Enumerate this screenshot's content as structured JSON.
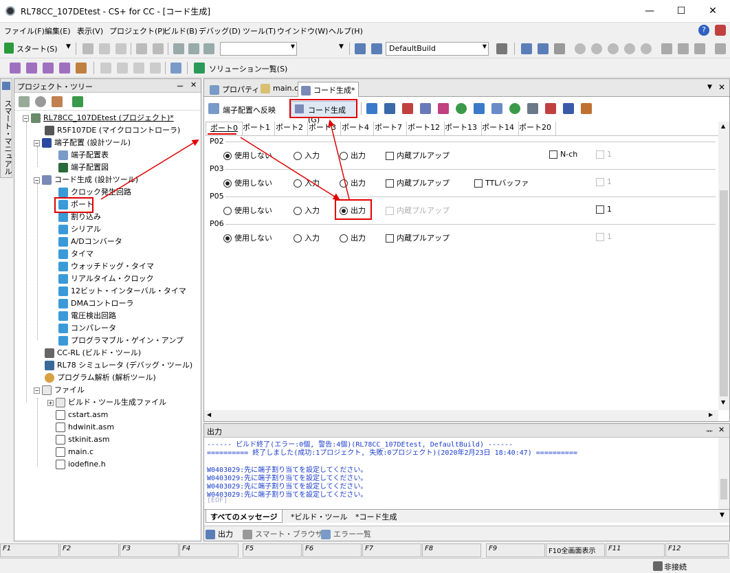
{
  "window": {
    "title": "RL78CC_107DEtest - CS+ for CC - [コード生成]",
    "min": "—",
    "max": "☐",
    "close": "✕"
  },
  "menu": [
    "ファイル(F)",
    "編集(E)",
    "表示(V)",
    "プロジェクト(P)",
    "ビルド(B)",
    "デバッグ(D)",
    "ツール(T)",
    "ウインドウ(W)",
    "ヘルプ(H)"
  ],
  "toolbar": {
    "start_label": "スタート(S)",
    "build_mode": "DefaultBuild",
    "solution_list": "ソリューション一覧(S)"
  },
  "smart_manual": "スマート・マニュアル",
  "project_tree": {
    "header": "プロジェクト・ツリー",
    "pin": "ᅲ",
    "close": "✕",
    "items": [
      {
        "label": "RL78CC_107DEtest (プロジェクト)*"
      },
      {
        "label": "R5F107DE (マイクロコントローラ)"
      },
      {
        "label": "端子配置 (設計ツール)"
      },
      {
        "label": "端子配置表"
      },
      {
        "label": "端子配置図"
      },
      {
        "label": "コード生成 (設計ツール)"
      },
      {
        "label": "クロック発生回路"
      },
      {
        "label": "ポート"
      },
      {
        "label": "割り込み"
      },
      {
        "label": "シリアル"
      },
      {
        "label": "A/Dコンバータ"
      },
      {
        "label": "タイマ"
      },
      {
        "label": "ウォッチドッグ・タイマ"
      },
      {
        "label": "リアルタイム・クロック"
      },
      {
        "label": "12ビット・インターバル・タイマ"
      },
      {
        "label": "DMAコントローラ"
      },
      {
        "label": "電圧検出回路"
      },
      {
        "label": "コンパレータ"
      },
      {
        "label": "プログラマブル・ゲイン・アンプ"
      },
      {
        "label": "CC-RL (ビルド・ツール)"
      },
      {
        "label": "RL78 シミュレータ (デバッグ・ツール)"
      },
      {
        "label": "プログラム解析 (解析ツール)"
      },
      {
        "label": "ファイル"
      },
      {
        "label": "ビルド・ツール生成ファイル"
      },
      {
        "label": "cstart.asm"
      },
      {
        "label": "hdwinit.asm"
      },
      {
        "label": "stkinit.asm"
      },
      {
        "label": "main.c"
      },
      {
        "label": "iodefine.h"
      }
    ]
  },
  "doc_tabs": [
    "プロパティ",
    "main.c",
    "コード生成*"
  ],
  "codegen": {
    "reflect_btn": "端子配置へ反映",
    "generate_btn": "コード生成(G)",
    "port_tabs": [
      "ポート0",
      "ポート1",
      "ポート2",
      "ポート3",
      "ポート4",
      "ポート7",
      "ポート12",
      "ポート13",
      "ポート14",
      "ポート20"
    ],
    "opt_unused": "使用しない",
    "opt_input": "入力",
    "opt_output": "出力",
    "opt_pullup": "内蔵プルアップ",
    "opt_nch": "N-ch",
    "opt_ttl": "TTLバッファ",
    "one": "1",
    "ports": [
      {
        "name": "P02",
        "selected": "使用しない"
      },
      {
        "name": "P03",
        "selected": "使用しない"
      },
      {
        "name": "P05",
        "selected": "出力"
      },
      {
        "name": "P06",
        "selected": "使用しない"
      }
    ]
  },
  "output": {
    "header": "出力",
    "lines": [
      "------ ビルド終了(エラー:0個, 警告:4個)(RL78CC_107DEtest, DefaultBuild) ------",
      "========== 終了しました(成功:1プロジェクト, 失敗:0プロジェクト)(2020年2月23日 18:40:47) ==========",
      "",
      "W0403029:先に端子割り当てを設定してください。",
      "W0403029:先に端子割り当てを設定してください。",
      "W0403029:先に端子割り当てを設定してください。",
      "W0403029:先に端子割り当てを設定してください。",
      "[EOF]"
    ],
    "tabs": [
      "すべてのメッセージ",
      "*ビルド・ツール",
      "*コード生成"
    ],
    "bottom_tabs": [
      "出力",
      "スマート・ブラウザー",
      "エラー一覧"
    ]
  },
  "fkeys": [
    "F1",
    "F2",
    "F3",
    "F4",
    "F5",
    "F6",
    "F7",
    "F8",
    "F9",
    "F10全画面表示",
    "F11",
    "F12"
  ],
  "status": {
    "connection": "非接続"
  },
  "colors": {
    "highlight_red": "#e00000",
    "output_text": "#1a3ccc"
  }
}
